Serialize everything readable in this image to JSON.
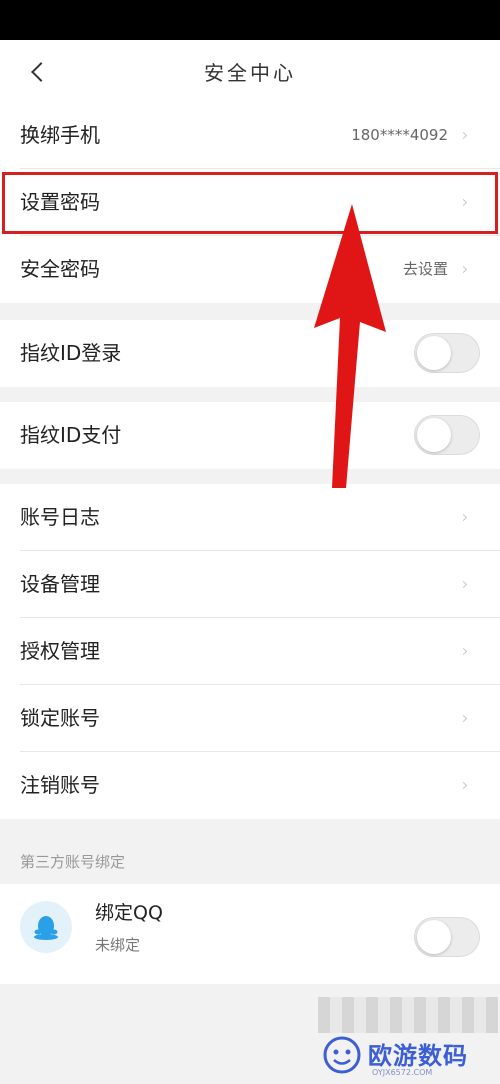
{
  "header": {
    "title": "安全中心"
  },
  "groups": {
    "account": [
      {
        "label": "换绑手机",
        "value": "180****4092"
      },
      {
        "label": "设置密码",
        "value": ""
      },
      {
        "label": "安全密码",
        "value": "去设置"
      }
    ],
    "fingerprint_login": {
      "label": "指纹ID登录",
      "enabled": false
    },
    "fingerprint_pay": {
      "label": "指纹ID支付",
      "enabled": false
    },
    "management": [
      {
        "label": "账号日志"
      },
      {
        "label": "设备管理"
      },
      {
        "label": "授权管理"
      },
      {
        "label": "锁定账号"
      },
      {
        "label": "注销账号"
      }
    ]
  },
  "third_party": {
    "section_label": "第三方账号绑定",
    "qq": {
      "title": "绑定QQ",
      "status": "未绑定",
      "enabled": false
    }
  },
  "watermark": {
    "text": "欧游数码",
    "url": "OYJX6572.COM"
  },
  "colors": {
    "highlight": "#d42020",
    "arrow": "#e01515",
    "watermark": "#3d5fd6"
  },
  "icons": {
    "back": "chevron-left-icon",
    "row": "chevron-right-icon",
    "qq": "qq-penguin-icon"
  }
}
